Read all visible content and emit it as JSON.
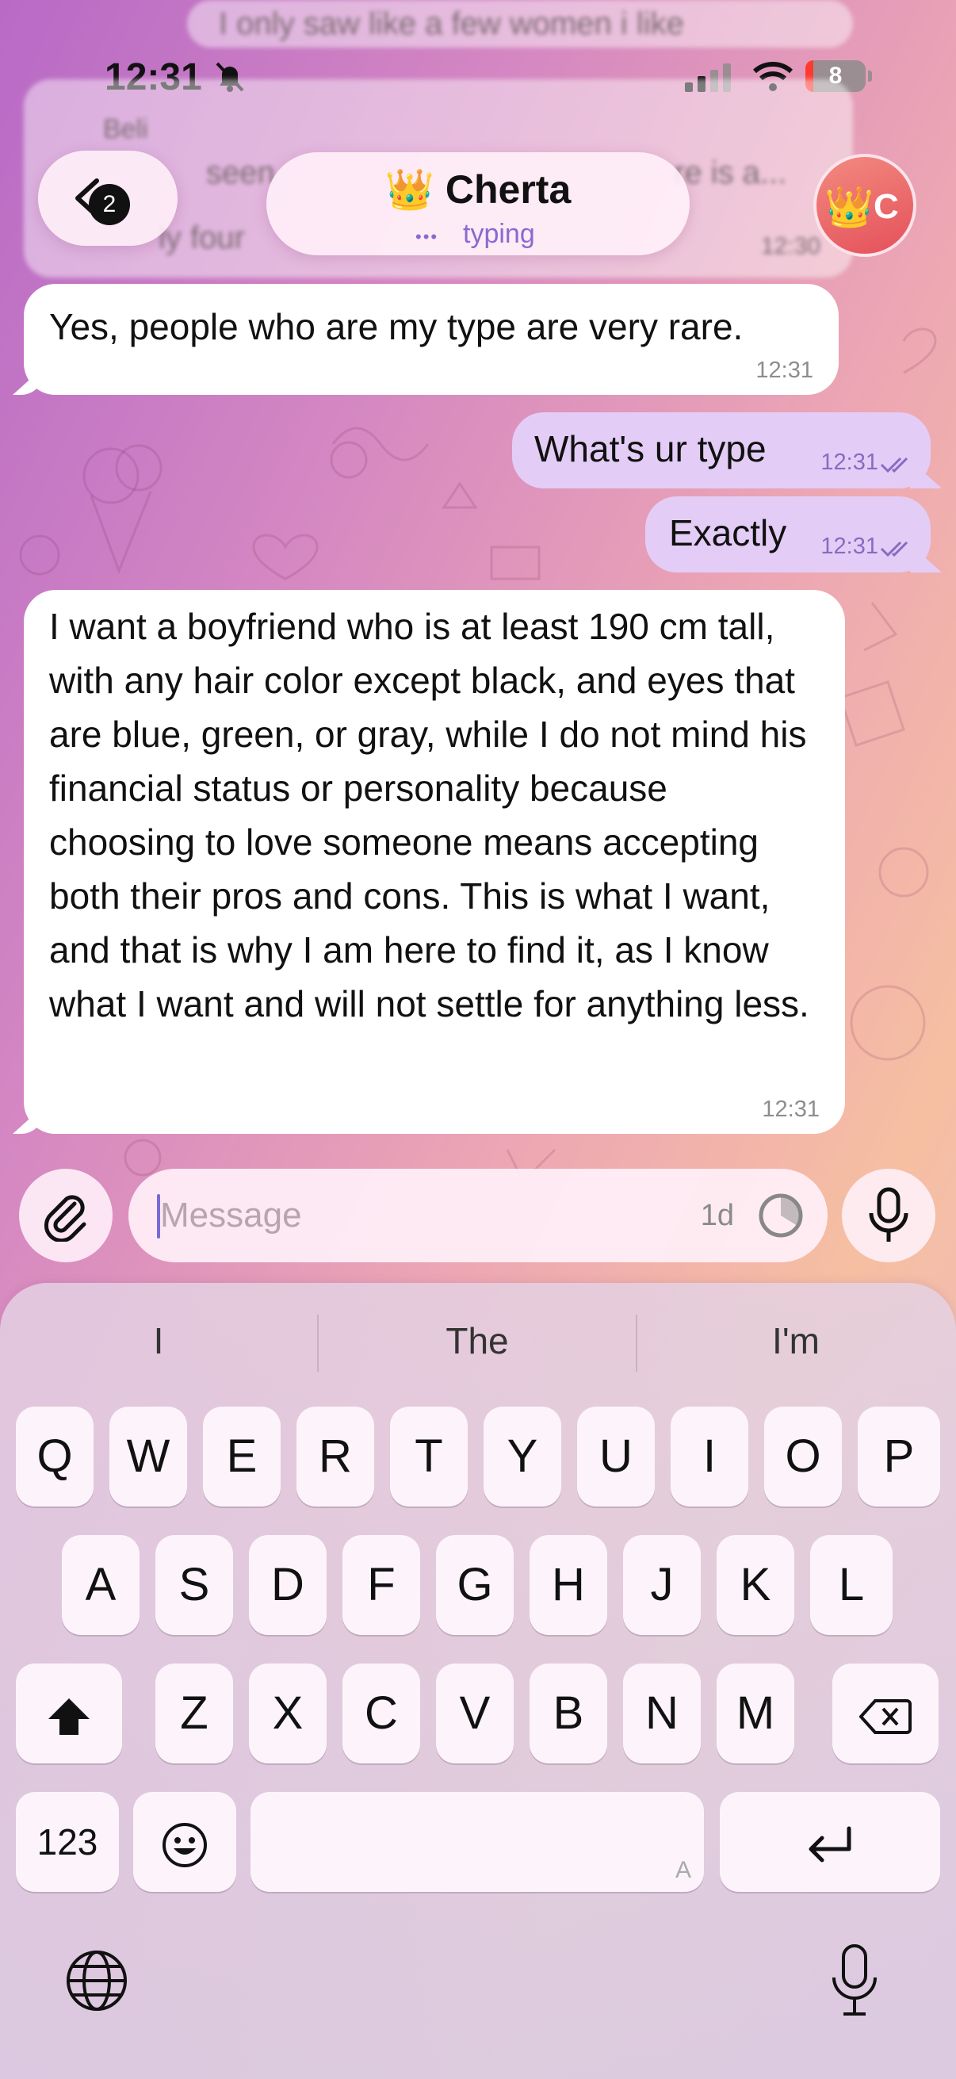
{
  "status_bar": {
    "time": "12:31",
    "battery": "8"
  },
  "faded_messages": [
    "I only saw like a few women i like",
    "Beli",
    "seen",
    "re is a...",
    "ly four",
    "12:30"
  ],
  "header": {
    "back_count": "2",
    "chat_name": "👑 Cherta",
    "typing_dots": "•••",
    "status": "typing",
    "avatar_letter": "C",
    "avatar_emoji": "👑"
  },
  "messages": [
    {
      "direction": "incoming",
      "text": "Yes, people who are my type are very rare.",
      "time": "12:31"
    },
    {
      "direction": "outgoing",
      "text": "What's ur type",
      "time": "12:31",
      "read": true
    },
    {
      "direction": "outgoing",
      "text": "Exactly",
      "time": "12:31",
      "read": true
    },
    {
      "direction": "incoming",
      "text": "I want a boyfriend who is at least 190 cm tall, with any hair color except black, and eyes that are blue, green, or gray, while I do not mind his financial status or personality because choosing to love someone means accepting both their pros and cons. This is what I want, and that is why I am here to find it, as I know what I want and will not settle for anything less.",
      "time": "12:31"
    }
  ],
  "composer": {
    "placeholder": "Message",
    "timer": "1d"
  },
  "keyboard": {
    "suggestions": [
      "I",
      "The",
      "I'm"
    ],
    "row1": [
      "Q",
      "W",
      "E",
      "R",
      "T",
      "Y",
      "U",
      "I",
      "O",
      "P"
    ],
    "row2": [
      "A",
      "S",
      "D",
      "F",
      "G",
      "H",
      "J",
      "K",
      "L"
    ],
    "row3": [
      "Z",
      "X",
      "C",
      "V",
      "B",
      "N",
      "M"
    ],
    "numbers_key": "123",
    "space_hint": "A"
  },
  "colors": {
    "accent": "#8a6ad0",
    "outgoing_bubble": "#e3cdf6",
    "incoming_bubble": "#ffffff"
  }
}
